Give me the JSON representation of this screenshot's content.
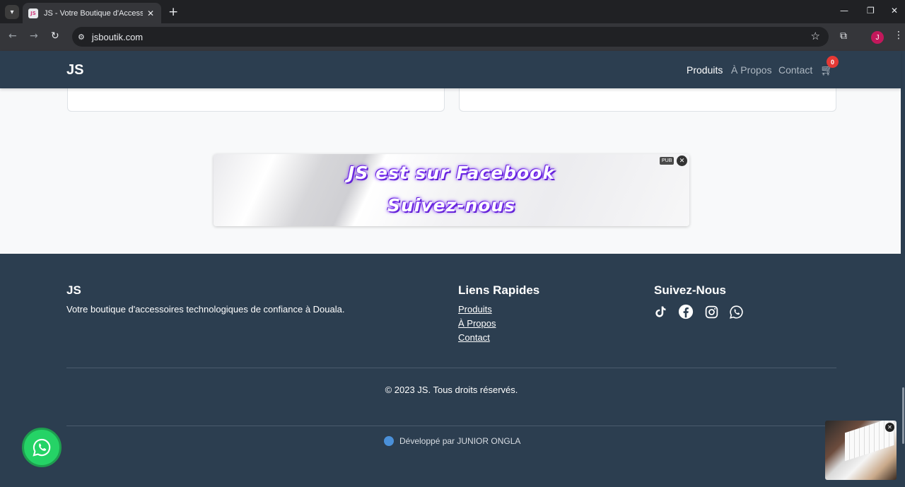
{
  "browser": {
    "tab_title": "JS - Votre Boutique d'Accessoires",
    "tab_favicon_text": "JS",
    "url": "jsboutik.com",
    "profile_initial": "J"
  },
  "navbar": {
    "brand": "JS",
    "links": [
      "Produits",
      "À Propos",
      "Contact"
    ],
    "cart_count": "0"
  },
  "ad": {
    "line1": "JS est sur Facebook",
    "line2": "Suivez-nous",
    "badge": "PUB"
  },
  "footer": {
    "brand_title": "JS",
    "description": "Votre boutique d'accessoires technologiques de confiance à Douala.",
    "quick_links_title": "Liens Rapides",
    "quick_links": [
      "Produits",
      "À Propos",
      "Contact"
    ],
    "social_title": "Suivez-Nous",
    "social_icons": [
      "tiktok-icon",
      "facebook-icon",
      "instagram-icon",
      "whatsapp-icon"
    ],
    "copyright": "© 2023 JS. Tous droits réservés.",
    "developer_credit": "Développé par JUNIOR ONGLA"
  },
  "colors": {
    "navbar_bg": "#2c3e50",
    "cart_badge": "#e53935",
    "whatsapp_green": "#25d366",
    "ad_text_glow": "#7b2ff7"
  }
}
